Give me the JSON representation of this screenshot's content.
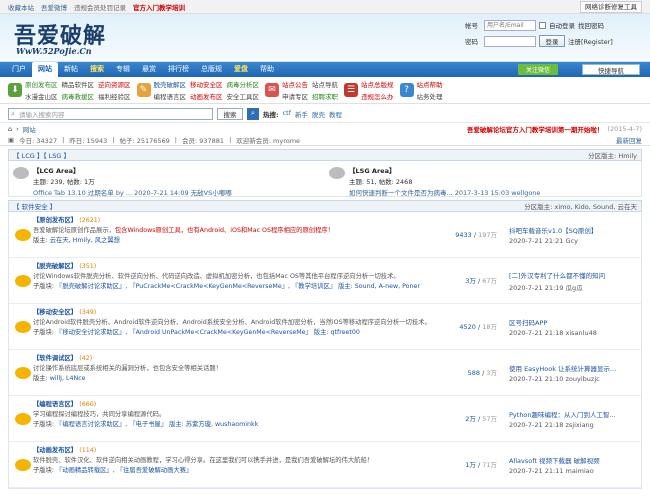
{
  "topbar": {
    "items": [
      "收藏本站",
      "吾爱微博",
      "违规会员处罚记录",
      "官方入门教学培训"
    ],
    "right": "网络诊断修复工具"
  },
  "logo": {
    "big": "吾爱破解",
    "url": "WwW.52PoJie.Cn"
  },
  "login": {
    "account_label": "帐号",
    "account_placeholder": "用户名/Email",
    "auto_login": "自动登录",
    "retrieve": "找回密码",
    "password_label": "密码",
    "login_btn": "登录",
    "register": "注册[Register]"
  },
  "nav": {
    "items": [
      "门户",
      "网站",
      "新帖",
      "搜索",
      "专辑",
      "悬赏",
      "排行榜",
      "总版规",
      "爱盘",
      "帮助"
    ],
    "active": 1,
    "attention": "关注微信",
    "quick": "快捷导航"
  },
  "qlinks": [
    {
      "icon": "download-icon",
      "color": "#5aa13d",
      "r1": [
        [
          "原创发布区",
          "g"
        ],
        [
          "精品软件区",
          "dk"
        ],
        [
          "逆向资源区",
          "rd"
        ]
      ],
      "r2": [
        [
          "水漫金山区",
          "dk"
        ],
        [
          "病毒救援区",
          "g"
        ],
        [
          "福利经验区",
          "dk"
        ]
      ]
    },
    {
      "icon": "tools-icon",
      "color": "#e6a23c",
      "r1": [
        [
          "脱壳破解区",
          "bl"
        ],
        [
          "移动安全区",
          "rd"
        ],
        [
          "病毒分析区",
          "g"
        ]
      ],
      "r2": [
        [
          "编程语言区",
          "dk"
        ],
        [
          "动画发布区",
          "rd"
        ],
        [
          "安全工具区",
          "dk"
        ]
      ]
    },
    {
      "icon": "announce-icon",
      "color": "#d9534f",
      "r1": [
        [
          "站点公告",
          "rd"
        ],
        [
          "站点导航",
          "dk"
        ]
      ],
      "r2": [
        [
          "申请专区",
          "dk"
        ],
        [
          "招聘求职",
          "g"
        ]
      ]
    },
    {
      "icon": "rules-icon",
      "color": "#c0392b",
      "r1": [
        [
          "站点总版规",
          "rd"
        ]
      ],
      "r2": [
        [
          "违规怎么办",
          "rd"
        ]
      ]
    },
    {
      "icon": "help-icon",
      "color": "#3a86cf",
      "r1": [
        [
          "站点帮助",
          "rd"
        ]
      ],
      "r2": [
        [
          "站务处理",
          "dk"
        ]
      ]
    }
  ],
  "search": {
    "placeholder": "请输入搜索内容",
    "select": "搜索",
    "hot_label": "热搜:",
    "hot": [
      "ctf",
      "新手",
      "脱壳",
      "教程"
    ]
  },
  "crumb": {
    "home": "网站",
    "notice": "吾爱破解论坛官方入门教学培训第一期开始啦！",
    "date": "(2015-4-7)"
  },
  "stats": {
    "text": [
      "今日: 34327",
      "昨日: 15943",
      "帖子: 25176569",
      "会员: 937881",
      "欢迎新会员: myrome"
    ],
    "right": "最新回复"
  },
  "lcg_head": {
    "title": "【 LCG 】【 LSG 】",
    "mod": "分区版主: Hmily"
  },
  "lcg": [
    {
      "name": "【LCG Area】",
      "meta": "主题: 239, 帖数: 1万",
      "last": "Office Tab 13.10 过期名单 by ... 2020-7-21 14:09 无敌VS小嘟嘟"
    },
    {
      "name": "【LSG Area】",
      "meta": "主题: 51, 帖数: 2468",
      "last": "如何快速判断一个文件是否为病毒... 2017-3-13 15:03 wellgone"
    }
  ],
  "soft_head": {
    "title": "【 软件安全 】",
    "mod": "分区版主: ximo, Kido, Sound, 云在天"
  },
  "forums": [
    {
      "name": "【原创发布区】",
      "count": "(2621)",
      "desc_pre": "吾爱破解论坛原创作品展示，",
      "desc_hl": "包含Windows原创工具，也有Android、iOS和Mac OS程序相应的原创程序！",
      "sub_label": "版主:",
      "sub": "云在天, Hmily, 风之翼想",
      "nums": "9433",
      "total": "197万",
      "last_t": "抖吧车载音乐v1.0【SQ原创】",
      "last_m": "2020-7-21 21:21 Gcy"
    },
    {
      "name": "【脱壳破解区】",
      "count": "(351)",
      "desc_pre": "讨论Windows软件脱壳分析、软件逆向分析、代码逆向改造、虚拟机加密分析，也包括Mac OS等其他平台程序逆向分析一切技术。",
      "desc_hl": "",
      "sub_label": "子版块:",
      "sub": "『脱壳破解讨论求助区』, 『PuCrackMe<CrackMe<KeyGenMe<ReverseMe』, 『教学培训区』 版主: Sound, A-new, Poner",
      "nums": "3万",
      "total": "67万",
      "last_t": "[二]外汉专利了什么都不懂的知问",
      "last_m": "2020-7-21 21:19 瓜g瓜"
    },
    {
      "name": "【移动安全区】",
      "count": "(349)",
      "desc_pre": "讨论Android软件脱壳分析、Android软件逆向分析、Android系统安全分析、Android软件加密分析，当然iOS等移动程序逆向分析一切技术。",
      "desc_hl": "",
      "sub_label": "子版块:",
      "sub": "『移动安全讨论求助区』, 『Android UnPackMe<CrackMe<KeyGenMe<ReverseMe』 版主: qtfreet00",
      "nums": "4520",
      "total": "18万",
      "last_t": "区号扫码APP",
      "last_m": "2020-7-21 21:18 xisanlu48"
    },
    {
      "name": "【软件调试区】",
      "count": "(42)",
      "desc_pre": "讨论操作系统底层或系统相关的漏洞分析，也包含安全等相关话题！",
      "desc_hl": "",
      "sub_label": "版主:",
      "sub": "willJ, L4Nce",
      "nums": "588",
      "total": "3万",
      "last_t": "使用 EasyHook 让系统计算器显示...",
      "last_m": "2020-7-21 21:10 zouyibuzjc"
    },
    {
      "name": "【编程语言区】",
      "count": "(660)",
      "desc_pre": "学习编程探讨编程技巧，共同分享编程源代码。",
      "desc_hl": "",
      "sub_label": "子版块:",
      "sub": "『编程语言讨论求助区』, 『电子书屋』 版主: 苏紫方璇, wushaominkk",
      "nums": "2万",
      "total": "57万",
      "last_t": "Python趣味编程：从入门到人工智...",
      "last_m": "2020-7-21 21:18 zsjixiang"
    },
    {
      "name": "【动画发布区】",
      "count": "(114)",
      "desc_pre": "软件脱壳、软件汉化、软件逆向相关动画教程，学习心得分享。在这里我们可以携手并进，是我们吾爱破解坛的伟大航船！",
      "desc_hl": "",
      "sub_label": "子版块:",
      "sub": "『动画精品转载区』, 『往届吾爱破解动画大赛』",
      "nums": "1万",
      "total": "71万",
      "last_t": "Allavsoft 视频下载器 破解视频",
      "last_m": "2020-7-21 21:11 maimiao"
    }
  ]
}
